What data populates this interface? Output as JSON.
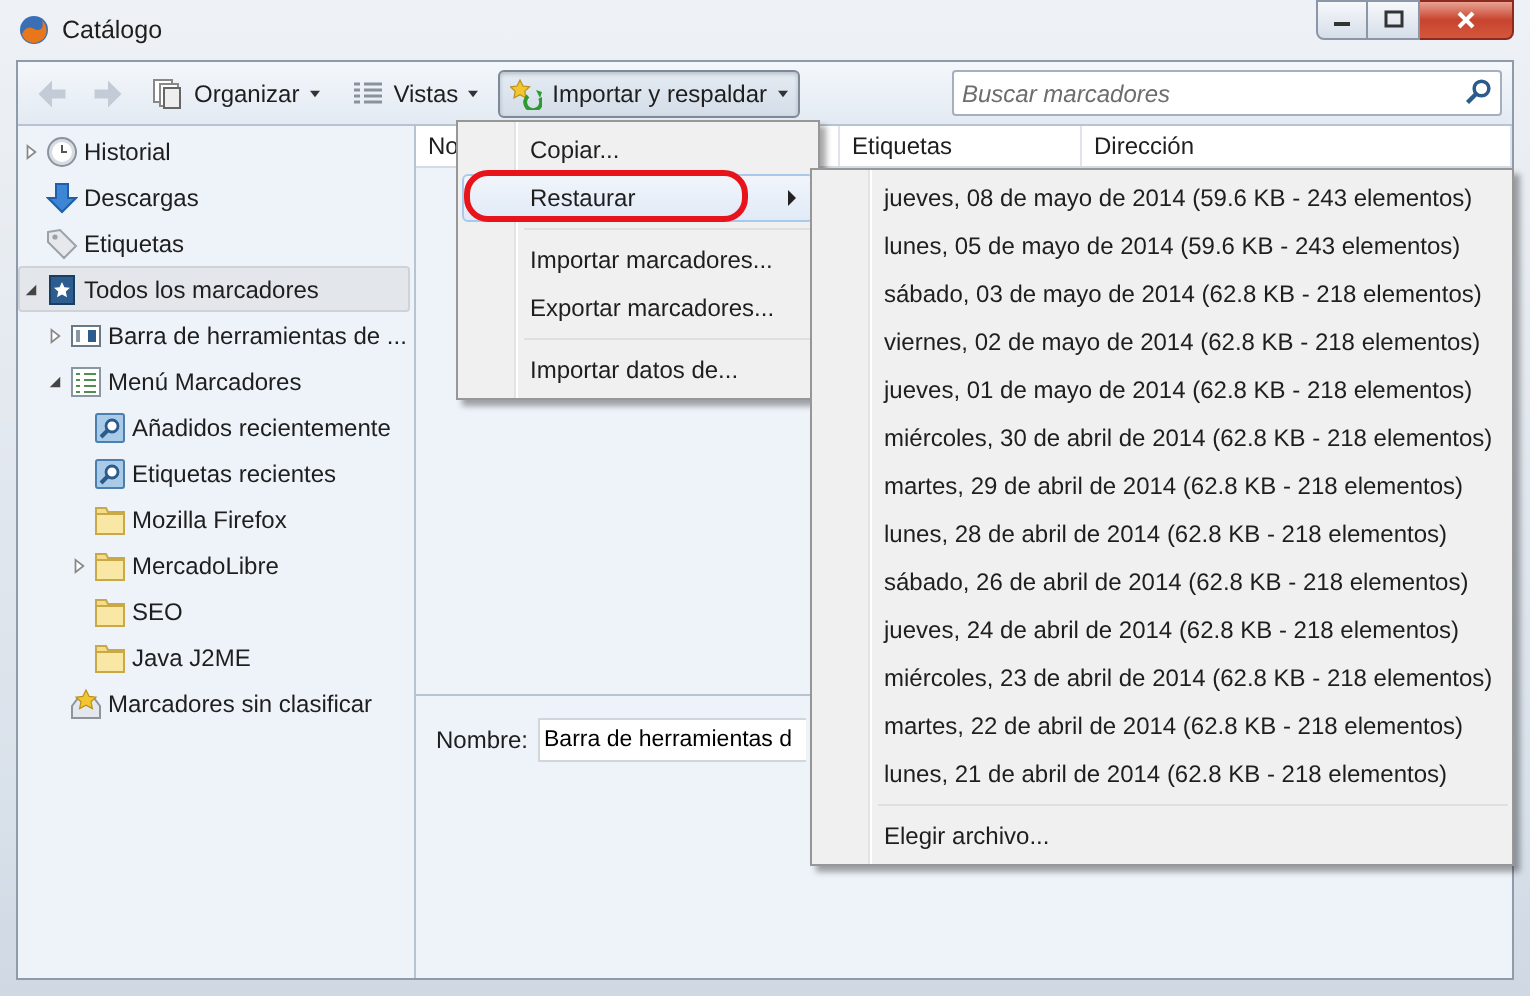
{
  "window": {
    "title": "Catálogo"
  },
  "toolbar": {
    "organize": "Organizar",
    "views": "Vistas",
    "import_backup": {
      "label": "Importar y respaldar",
      "pressed": true
    },
    "search": {
      "placeholder": "Buscar marcadores"
    }
  },
  "sidebar": {
    "items": [
      {
        "kind": "history",
        "label": "Historial",
        "expanded": false,
        "selected": false
      },
      {
        "kind": "download",
        "label": "Descargas",
        "selected": false
      },
      {
        "kind": "tag",
        "label": "Etiquetas",
        "selected": false
      },
      {
        "kind": "library",
        "label": "Todos los marcadores",
        "expanded": true,
        "selected": true,
        "children": [
          {
            "kind": "toolbar",
            "label": "Barra de herramientas de ...",
            "expanded": false,
            "selected": false
          },
          {
            "kind": "menu",
            "label": "Menú Marcadores",
            "expanded": true,
            "selected": false,
            "children": [
              {
                "kind": "query",
                "label": "Añadidos recientemente",
                "selected": false
              },
              {
                "kind": "query",
                "label": "Etiquetas recientes",
                "selected": false
              },
              {
                "kind": "folder",
                "label": "Mozilla Firefox",
                "selected": false
              },
              {
                "kind": "folder",
                "label": "MercadoLibre",
                "expanded": false,
                "selected": false
              },
              {
                "kind": "folder",
                "label": "SEO",
                "selected": false
              },
              {
                "kind": "folder",
                "label": "Java J2ME",
                "selected": false
              }
            ]
          },
          {
            "kind": "unsorted",
            "label": "Marcadores sin clasificar",
            "selected": false
          }
        ]
      }
    ]
  },
  "columns": [
    "No",
    "Etiquetas",
    "Dirección"
  ],
  "details": {
    "name_label": "Nombre:",
    "name_value": "Barra de herramientas d"
  },
  "menu": {
    "items": [
      {
        "kind": "item",
        "label": "Copiar...",
        "selected": false,
        "circled": false
      },
      {
        "kind": "item",
        "label": "Restaurar",
        "selected": true,
        "circled": true,
        "has_submenu": true
      },
      {
        "kind": "separator"
      },
      {
        "kind": "item",
        "label": "Importar marcadores...",
        "selected": false,
        "circled": false
      },
      {
        "kind": "item",
        "label": "Exportar marcadores...",
        "selected": false,
        "circled": false
      },
      {
        "kind": "separator"
      },
      {
        "kind": "item",
        "label": "Importar datos de...",
        "selected": false,
        "circled": false
      }
    ]
  },
  "submenu": {
    "items": [
      {
        "kind": "item",
        "label": "jueves, 08 de mayo de 2014 (59.6 KB - 243 elementos)"
      },
      {
        "kind": "item",
        "label": "lunes, 05 de mayo de 2014 (59.6 KB - 243 elementos)"
      },
      {
        "kind": "item",
        "label": "sábado, 03 de mayo de 2014 (62.8 KB - 218 elementos)"
      },
      {
        "kind": "item",
        "label": "viernes, 02 de mayo de 2014 (62.8 KB - 218 elementos)"
      },
      {
        "kind": "item",
        "label": "jueves, 01 de mayo de 2014 (62.8 KB - 218 elementos)"
      },
      {
        "kind": "item",
        "label": "miércoles, 30 de abril de 2014 (62.8 KB - 218 elementos)"
      },
      {
        "kind": "item",
        "label": "martes, 29 de abril de 2014 (62.8 KB - 218 elementos)"
      },
      {
        "kind": "item",
        "label": "lunes, 28 de abril de 2014 (62.8 KB - 218 elementos)"
      },
      {
        "kind": "item",
        "label": "sábado, 26 de abril de 2014 (62.8 KB - 218 elementos)"
      },
      {
        "kind": "item",
        "label": "jueves, 24 de abril de 2014 (62.8 KB - 218 elementos)"
      },
      {
        "kind": "item",
        "label": "miércoles, 23 de abril de 2014 (62.8 KB - 218 elementos)"
      },
      {
        "kind": "item",
        "label": "martes, 22 de abril de 2014 (62.8 KB - 218 elementos)"
      },
      {
        "kind": "item",
        "label": "lunes, 21 de abril de 2014 (62.8 KB - 218 elementos)"
      },
      {
        "kind": "separator"
      },
      {
        "kind": "item",
        "label": "Elegir archivo..."
      }
    ]
  }
}
